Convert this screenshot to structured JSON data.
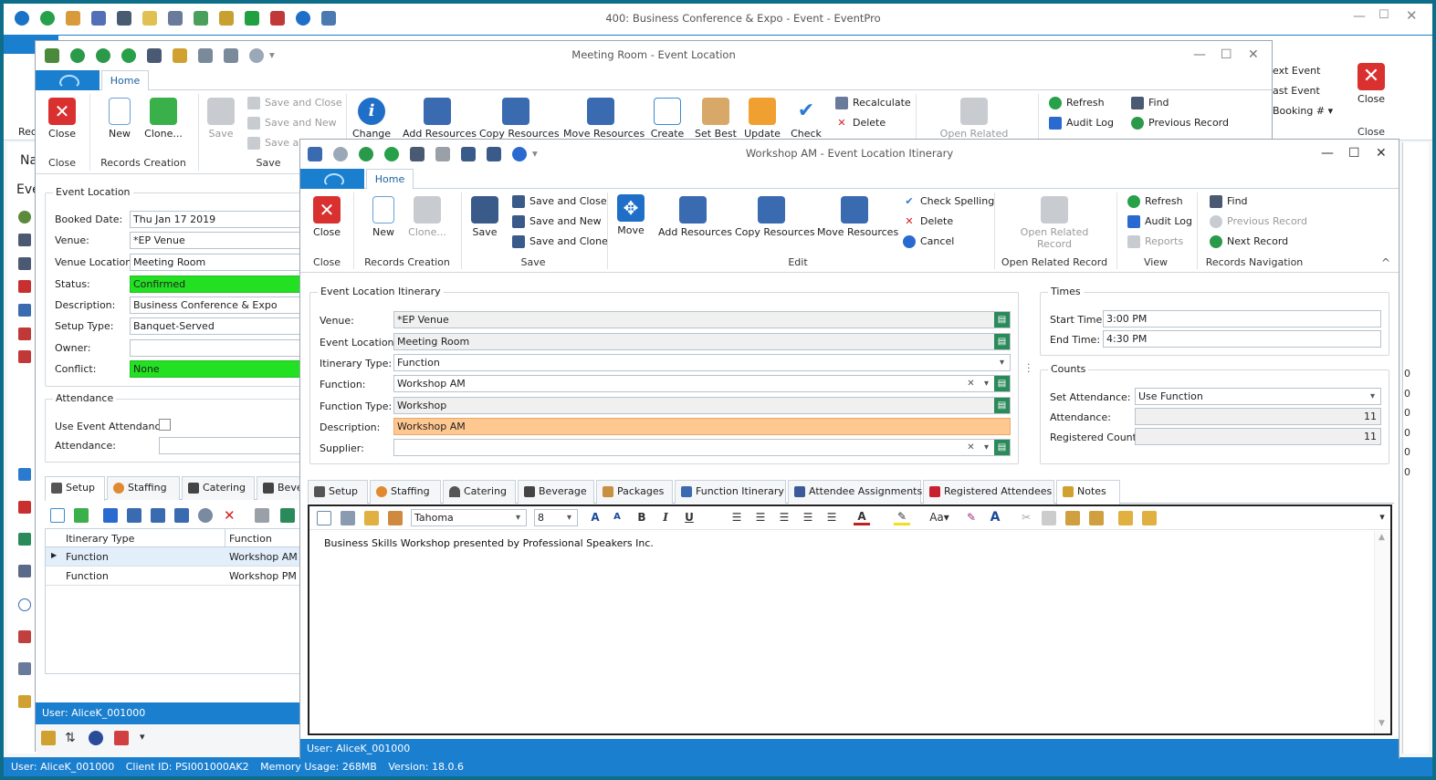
{
  "main_window": {
    "title": "400: Business Conference & Expo - Event - EventPro",
    "ribbon_right": {
      "next_event": "ext Event",
      "last_event": "ast Event",
      "booking": "Booking #",
      "close": "Close",
      "group_close": "Close"
    },
    "left_rec": "Rec",
    "left_nav": "Na",
    "left_eve": "Eve",
    "status": {
      "user": "User: AliceK_001000",
      "client": "Client ID: PSI001000AK2",
      "memory": "Memory Usage: 268MB",
      "version": "Version: 18.0.6"
    }
  },
  "meeting_window": {
    "title": "Meeting Room - Event Location",
    "home_tab": "Home",
    "ribbon": {
      "close": "Close",
      "new": "New",
      "clone": "Clone...",
      "save": "Save",
      "save_and_close": "Save and Close",
      "save_and_new": "Save and New",
      "save_and": "Save an",
      "change": "Change",
      "add_resources": "Add Resources",
      "copy_resources": "Copy Resources",
      "move_resources": "Move Resources",
      "create": "Create",
      "set_best": "Set Best",
      "update": "Update",
      "check": "Check",
      "recalculate": "Recalculate",
      "delete": "Delete",
      "open_related": "Open Related",
      "refresh": "Refresh",
      "audit_log": "Audit Log",
      "find": "Find",
      "previous_record": "Previous Record",
      "group_close": "Close",
      "group_records_creation": "Records Creation",
      "group_save": "Save"
    },
    "event_location": {
      "caption": "Event Location",
      "booked_date_label": "Booked Date:",
      "booked_date": "Thu Jan 17 2019",
      "venue_label": "Venue:",
      "venue": "*EP Venue",
      "venue_location_label": "Venue Location:",
      "venue_location": "Meeting Room",
      "status_label": "Status:",
      "status": "Confirmed",
      "description_label": "Description:",
      "description": "Business Conference & Expo",
      "setup_type_label": "Setup Type:",
      "setup_type": "Banquet-Served",
      "owner_label": "Owner:",
      "owner": "",
      "conflict_label": "Conflict:",
      "conflict": "None"
    },
    "attendance": {
      "caption": "Attendance",
      "use_event_attendance_label": "Use Event Attendance",
      "attendance_label": "Attendance:",
      "attendance": ""
    },
    "tabs": [
      "Setup",
      "Staffing",
      "Catering",
      "Beve"
    ],
    "grid": {
      "headers": [
        "Itinerary Type",
        "Function"
      ],
      "rows": [
        [
          "Function",
          "Workshop AM"
        ],
        [
          "Function",
          "Workshop PM"
        ]
      ]
    },
    "status_user": "User: AliceK_001000"
  },
  "workshop_window": {
    "title": "Workshop AM - Event Location Itinerary",
    "home_tab": "Home",
    "ribbon": {
      "close": "Close",
      "new": "New",
      "clone": "Clone...",
      "save": "Save",
      "save_and_close": "Save and Close",
      "save_and_new": "Save and New",
      "save_and_clone": "Save and Clone",
      "move": "Move",
      "add_resources": "Add Resources",
      "copy_resources": "Copy Resources",
      "move_resources": "Move Resources",
      "check_spelling": "Check Spelling",
      "delete": "Delete",
      "cancel": "Cancel",
      "open_related_record_1": "Open Related",
      "open_related_record_2": "Record",
      "refresh": "Refresh",
      "audit_log": "Audit Log",
      "reports": "Reports",
      "find": "Find",
      "previous_record": "Previous Record",
      "next_record": "Next Record",
      "group_close": "Close",
      "group_records_creation": "Records Creation",
      "group_save": "Save",
      "group_edit": "Edit",
      "group_open_related_record": "Open Related Record",
      "group_view": "View",
      "group_records_navigation": "Records Navigation"
    },
    "itinerary": {
      "caption": "Event Location Itinerary",
      "venue_label": "Venue:",
      "venue": "*EP Venue",
      "event_location_label": "Event Location:",
      "event_location": "Meeting Room",
      "itinerary_type_label": "Itinerary Type:",
      "itinerary_type": "Function",
      "function_label": "Function:",
      "function": "Workshop AM",
      "function_type_label": "Function Type:",
      "function_type": "Workshop",
      "description_label": "Description:",
      "description": "Workshop AM",
      "supplier_label": "Supplier:",
      "supplier": ""
    },
    "times": {
      "caption": "Times",
      "start_time_label": "Start Time:",
      "start_time": "3:00 PM",
      "end_time_label": "End Time:",
      "end_time": "4:30 PM"
    },
    "counts": {
      "caption": "Counts",
      "set_attendance_label": "Set Attendance:",
      "set_attendance": "Use Function",
      "attendance_label": "Attendance:",
      "attendance": "11",
      "registered_count_label": "Registered Count:",
      "registered_count": "11"
    },
    "tabs": [
      "Setup",
      "Staffing",
      "Catering",
      "Beverage",
      "Packages",
      "Function Itinerary",
      "Attendee Assignments",
      "Registered Attendees",
      "Notes"
    ],
    "editor": {
      "font": "Tahoma",
      "size": "8",
      "text": "Business Skills Workshop presented by Professional Speakers Inc."
    },
    "status_user": "User: AliceK_001000"
  },
  "colors": {
    "accent": "#1b7fcf",
    "status_green": "#22e022",
    "description_orange": "#ffc890",
    "close_red": "#d93030"
  }
}
